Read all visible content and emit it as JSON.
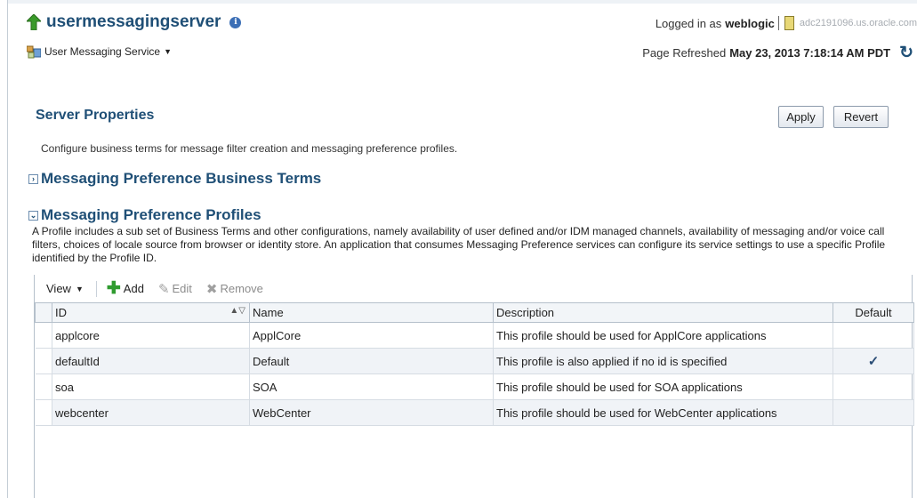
{
  "header": {
    "title": "usermessagingserver",
    "menu_label": "User Messaging Service",
    "logged_in_prefix": "Logged in as",
    "user": "weblogic",
    "host": "adc2191096.us.oracle.com",
    "refresh_prefix": "Page Refreshed",
    "refresh_time": "May 23, 2013 7:18:14 AM PDT"
  },
  "section": {
    "title": "Server Properties",
    "apply_label": "Apply",
    "revert_label": "Revert",
    "description": "Configure business terms for message filter creation and messaging preference profiles."
  },
  "terms_section": {
    "title": "Messaging Preference Business Terms",
    "expanded": false
  },
  "profiles_section": {
    "title": "Messaging Preference Profiles",
    "expanded": true,
    "description": "A Profile includes a sub set of Business Terms and other configurations, namely availability of user defined and/or IDM managed channels, availability of messaging and/or voice call filters, choices of locale source from browser or identity store. An application that consumes Messaging Preference services can configure its service settings to use a specific Profile identified by the Profile ID."
  },
  "toolbar": {
    "view_label": "View",
    "add_label": "Add",
    "edit_label": "Edit",
    "remove_label": "Remove"
  },
  "table": {
    "columns": [
      "ID",
      "Name",
      "Description",
      "Default"
    ],
    "rows": [
      {
        "id": "applcore",
        "name": "ApplCore",
        "description": "This profile should be used for ApplCore applications",
        "default": ""
      },
      {
        "id": "defaultId",
        "name": "Default",
        "description": "This profile is also applied if no id is specified",
        "default": "✓"
      },
      {
        "id": "soa",
        "name": "SOA",
        "description": "This profile should be used for SOA applications",
        "default": ""
      },
      {
        "id": "webcenter",
        "name": "WebCenter",
        "description": "This profile should be used for WebCenter applications",
        "default": ""
      }
    ]
  },
  "icons": {
    "up_arrow": "up-arrow-icon",
    "info": "info-icon",
    "app": "app-icon",
    "refresh": "refresh-icon",
    "add": "plus-icon",
    "edit": "pencil-icon",
    "remove": "x-icon",
    "check": "check-icon"
  },
  "colors": {
    "title_blue": "#1f4f76",
    "add_green": "#2f9b2f"
  }
}
